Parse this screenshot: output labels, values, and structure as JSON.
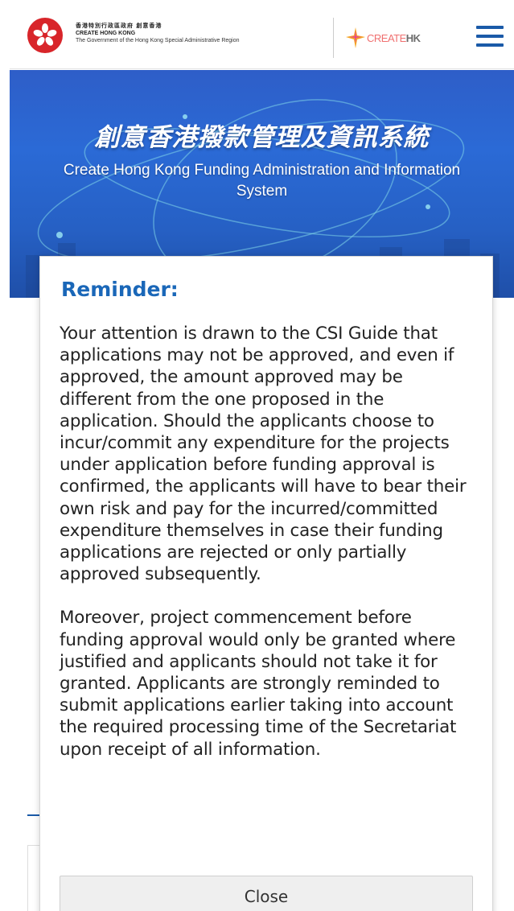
{
  "header": {
    "gov_name_zh": "香港特別行政區政府 創意香港",
    "gov_name_en_short": "CREATE HONG KONG",
    "gov_name_en_full": "The Government of the Hong Kong Special Administrative Region",
    "brand_logo_prefix": "CREATE",
    "brand_logo_suffix": "HK",
    "menu_icon": "hamburger-menu-icon"
  },
  "banner": {
    "title_zh": "創意香港撥款管理及資訊系統",
    "title_en": "Create Hong Kong Funding Administration and Information System"
  },
  "modal": {
    "title": "Reminder:",
    "paragraphs": [
      "Your attention is drawn to the CSI Guide that applications may not be approved, and even if approved, the amount approved may be different from the one proposed in the application. Should the applicants choose to incur/commit any expenditure for the projects under application before funding approval is confirmed, the applicants will have to bear their own risk and pay for the incurred/committed expenditure themselves in case their funding applications are rejected or only partially approved subsequently.",
      "Moreover, project commencement before funding approval would only be granted where justified and applicants should not take it for granted. Applicants are strongly reminded to submit applications earlier taking into account the required processing time of the Secretariat upon receipt of all information."
    ],
    "close_label": "Close"
  },
  "colors": {
    "accent_blue": "#1a67b8",
    "banner_blue": "#2b6ad6",
    "emblem_red": "#d8252a"
  }
}
